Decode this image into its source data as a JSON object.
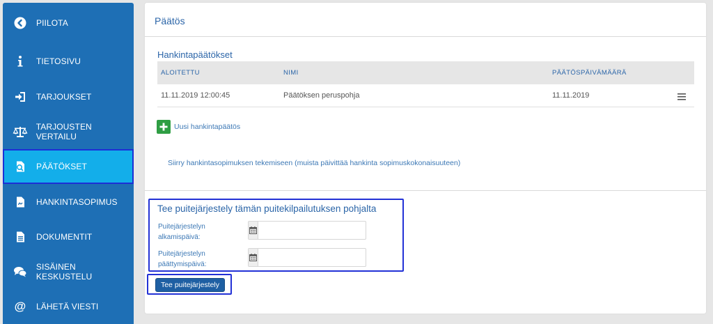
{
  "sidebar": {
    "items": [
      {
        "label": "PIILOTA",
        "icon": "chevron-left-circle-icon"
      },
      {
        "label": "TIETOSIVU",
        "icon": "info-icon"
      },
      {
        "label": "TARJOUKSET",
        "icon": "sign-in-icon"
      },
      {
        "label": "TARJOUSTEN VERTAILU",
        "icon": "balance-scale-icon"
      },
      {
        "label": "PÄÄTÖKSET",
        "icon": "decision-document-icon"
      },
      {
        "label": "HANKINTASOPIMUS",
        "icon": "contract-document-icon"
      },
      {
        "label": "DOKUMENTIT",
        "icon": "document-icon"
      },
      {
        "label": "SISÄINEN KESKUSTELU",
        "icon": "comments-icon"
      },
      {
        "label": "LÄHETÄ VIESTI",
        "icon": "at-sign-icon"
      }
    ],
    "active_index": 4
  },
  "panel": {
    "title": "Päätös"
  },
  "decisions": {
    "title": "Hankintapäätökset",
    "columns": [
      "ALOITETTU",
      "NIMI",
      "PÄÄTÖSPÄIVÄMÄÄRÄ"
    ],
    "rows": [
      {
        "started": "11.11.2019 12:00:45",
        "name": "Päätöksen peruspohja",
        "decision_date": "11.11.2019"
      }
    ],
    "add_label": "Uusi hankintapäätös",
    "link_text": "Siirry hankintasopimuksen tekemiseen (muista päivittää hankinta sopimuskokonaisuuteen)"
  },
  "framework": {
    "title": "Tee puitejärjestely tämän puitekilpailutuksen pohjalta",
    "start_label_line1": "Puitejärjestelyn",
    "start_label_line2": "alkamispäivä:",
    "start_value": "",
    "end_label_line1": "Puitejärjestelyn",
    "end_label_line2": "päättymispäivä:",
    "end_value": "",
    "submit_label": "Tee puitejärjestely"
  },
  "colors": {
    "sidebar_bg": "#1e6fb5",
    "sidebar_active": "#13aeea",
    "highlight_border": "#2231d6",
    "title_blue": "#2b65a8",
    "add_green": "#2f9e44",
    "button_blue": "#1e5fa3"
  }
}
